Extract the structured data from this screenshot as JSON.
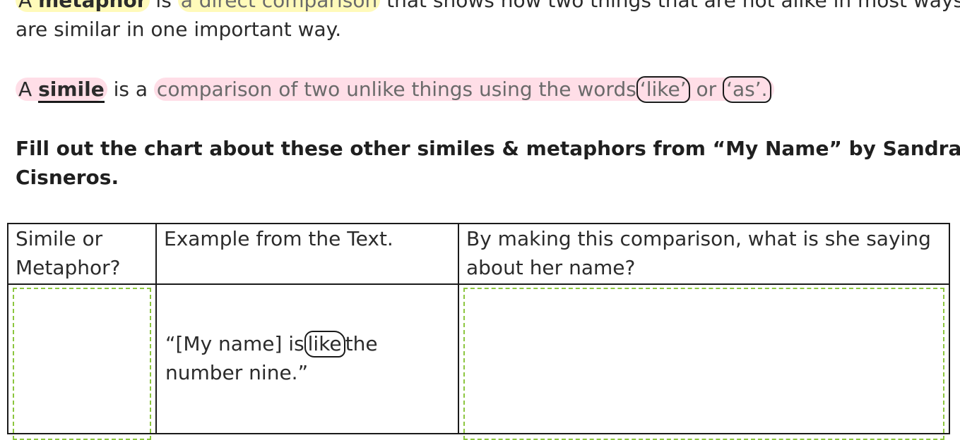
{
  "metaphor_definition": {
    "prefix": "A ",
    "term": "metaphor",
    "after_term": " is ",
    "highlight": "a direct comparison",
    "line1_rest": " that shows how two things that are not alike in most ways",
    "line2": "are similar in one important way."
  },
  "simile_definition": {
    "prefix": "A ",
    "term": "simile",
    "after_term": " is a ",
    "highlight": "comparison of two unlike things using the words",
    "word1": "‘like’",
    "connector": " or ",
    "word2": "‘as’."
  },
  "instructions": {
    "line1": "Fill out the chart about these other similes & metaphors from “My Name” by Sandra",
    "line2": "Cisneros."
  },
  "table": {
    "headers": [
      [
        "Simile or",
        "Metaphor?"
      ],
      [
        "Example from the Text."
      ],
      [
        "By making this comparison, what is she saying",
        "about her name?"
      ]
    ],
    "example": {
      "before": "“[My name] is",
      "circled": "like",
      "after": "the",
      "line2": "number nine.”"
    }
  },
  "colors": {
    "highlight_yellow": "#fff582",
    "highlight_pink": "#ffa0b9",
    "answer_box_dash": "#8cc63f",
    "ink": "#1a1a1a"
  }
}
